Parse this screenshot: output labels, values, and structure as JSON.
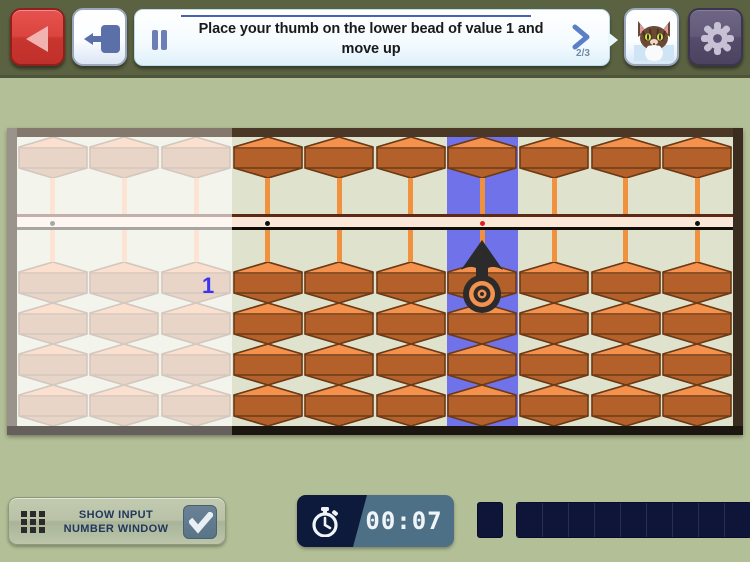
{
  "app": {
    "background_color": "#b3bf96",
    "topbar_color": "#5b6242"
  },
  "topbar": {
    "back_button": {
      "name": "back",
      "icon": "triangle-left-icon",
      "color": "#db4540"
    },
    "exit_button": {
      "name": "exit",
      "icon": "exit-door-icon",
      "color": "#5b6fa8"
    },
    "avatar_button": {
      "name": "avatar",
      "icon": "cat-avatar-icon"
    },
    "settings_button": {
      "name": "settings",
      "icon": "gear-icon",
      "color": "#635a79"
    }
  },
  "instruction": {
    "text": "Place your thumb on the lower bead of value 1 and move up",
    "pause_icon": "pause-icon",
    "next_icon": "chevron-right-icon",
    "step_counter": "2/3",
    "progress_color": "#4a63b0",
    "current_step": 2,
    "total_steps": 3
  },
  "abacus": {
    "columns": 10,
    "upper_beads_per_column": 1,
    "lower_beads_per_column": 4,
    "active_column_index": 6,
    "highlight_color": "#6f72e8",
    "dimmed_columns": [
      0,
      1,
      2
    ],
    "bar_dot_columns": [
      0,
      3,
      6,
      9
    ],
    "active_dot_color": "#e02020",
    "inactive_dot_color": "#111111",
    "bead_color": "#f3914d",
    "bead_shadow_color": "#b4602a",
    "rod_color": "#f0913e",
    "board_color": "#dfe3cd",
    "frame_color": "#5f5346",
    "value_labels": [
      {
        "text": "1",
        "column_index": 2,
        "color": "#3a35f0"
      }
    ],
    "pointer": {
      "icon": "up-arrow-target-icon",
      "column_index": 6,
      "target_bead": "lower-bead-1"
    }
  },
  "bottom_bar": {
    "show_input_toggle": {
      "label_line1": "SHOW INPUT",
      "label_line2": "NUMBER WINDOW",
      "grid_icon": "grid-3x3-icon",
      "checked": true,
      "check_icon": "check-icon"
    },
    "timer": {
      "icon": "stopwatch-icon",
      "value": "00:07",
      "icon_bg": "#0e1a3c",
      "value_bg": "#4d7087"
    },
    "progress_tracker": {
      "first_slot_filled": false,
      "segments": 9,
      "filled": 0,
      "empty_color": "#0e1538"
    }
  }
}
